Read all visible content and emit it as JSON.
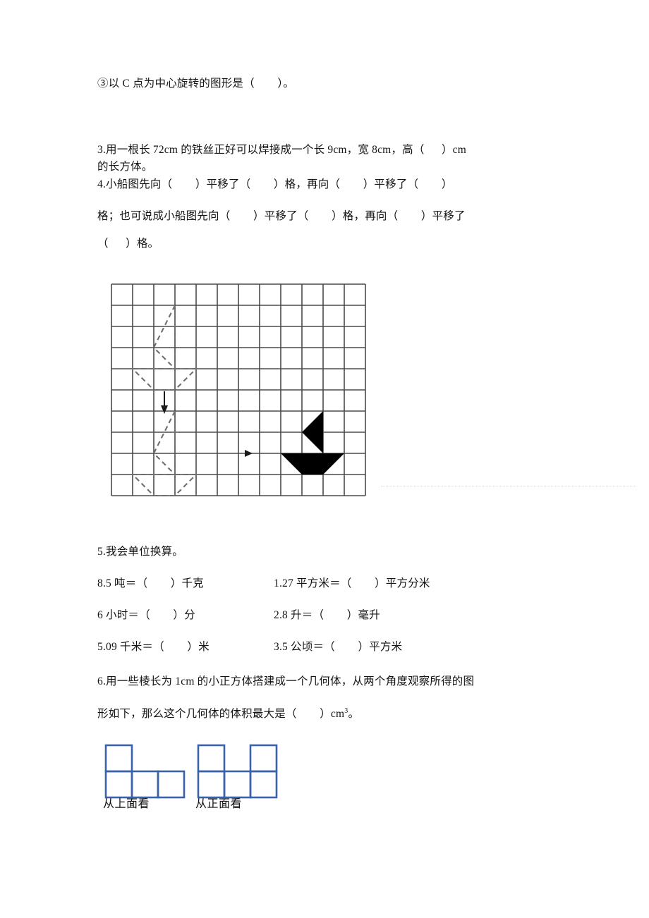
{
  "document": {
    "type": "math-worksheet",
    "language": "zh-CN"
  },
  "questions": {
    "q2c": {
      "line1": "③以 C 点为中心旋转的图形是（        ）。"
    },
    "q3": {
      "line1": "3.用一根长 72cm 的铁丝正好可以焊接成一个长 9cm，宽 8cm，高（      ）cm",
      "line2": "的长方体。"
    },
    "q4": {
      "line1": "4.小船图先向（        ）平移了（        ）格，再向（        ）平移了（        ）",
      "line2": "格；也可说成小船图先向（        ）平移了（        ）格，再向（        ）平移了",
      "line3": "（      ）格。"
    },
    "q5": {
      "title": "5.我会单位换算。",
      "rows": [
        {
          "left": "8.5 吨＝（        ）千克",
          "right": "1.27 平方米＝（        ）平方分米"
        },
        {
          "left": "6 小时＝（        ）分",
          "right": "2.8 升＝（        ）毫升"
        },
        {
          "left": "5.09 千米＝（        ）米",
          "right": "3.5 公顷＝（        ）平方米"
        }
      ]
    },
    "q6": {
      "line1": "6.用一些棱长为 1cm 的小正方体搭建成一个几何体，从两个角度观察所得的图",
      "line2_pre": "形如下，那么这个几何体的体积最大是（        ）cm",
      "line2_sup": "3",
      "line2_post": "。"
    }
  },
  "grid_figure": {
    "name": "translation-grid",
    "columns": 12,
    "rows": 10,
    "cell_size": 30,
    "line_color": "#4a4a4a",
    "dashed_color": "#7a7a7a",
    "solid_boat_color": "#000000",
    "arrows": [
      {
        "name": "vertical-down-arrow",
        "from": [
          2.5,
          4
        ],
        "to": [
          2.5,
          6
        ]
      },
      {
        "name": "horizontal-right-arrow",
        "from": [
          6.4,
          8
        ],
        "to": [
          7.0,
          8
        ]
      }
    ],
    "dashed_boats": [
      {
        "name": "dashed-boat-upper",
        "origin": [
          1,
          1
        ]
      },
      {
        "name": "dashed-boat-lower",
        "origin": [
          1,
          6
        ]
      }
    ],
    "solid_boat": {
      "name": "solid-boat",
      "origin": [
        8,
        6
      ]
    }
  },
  "view_figures": {
    "top_view": {
      "label": "从上面看",
      "cells": [
        [
          0,
          0
        ],
        [
          0,
          1
        ],
        [
          1,
          1
        ],
        [
          2,
          1
        ]
      ],
      "cell_size": 37,
      "stroke": "#3a62a8"
    },
    "front_view": {
      "label": "从正面看",
      "cells": [
        [
          0,
          0
        ],
        [
          2,
          0
        ],
        [
          0,
          1
        ],
        [
          1,
          1
        ],
        [
          2,
          1
        ]
      ],
      "cell_size": 37,
      "stroke": "#3a62a8"
    }
  }
}
